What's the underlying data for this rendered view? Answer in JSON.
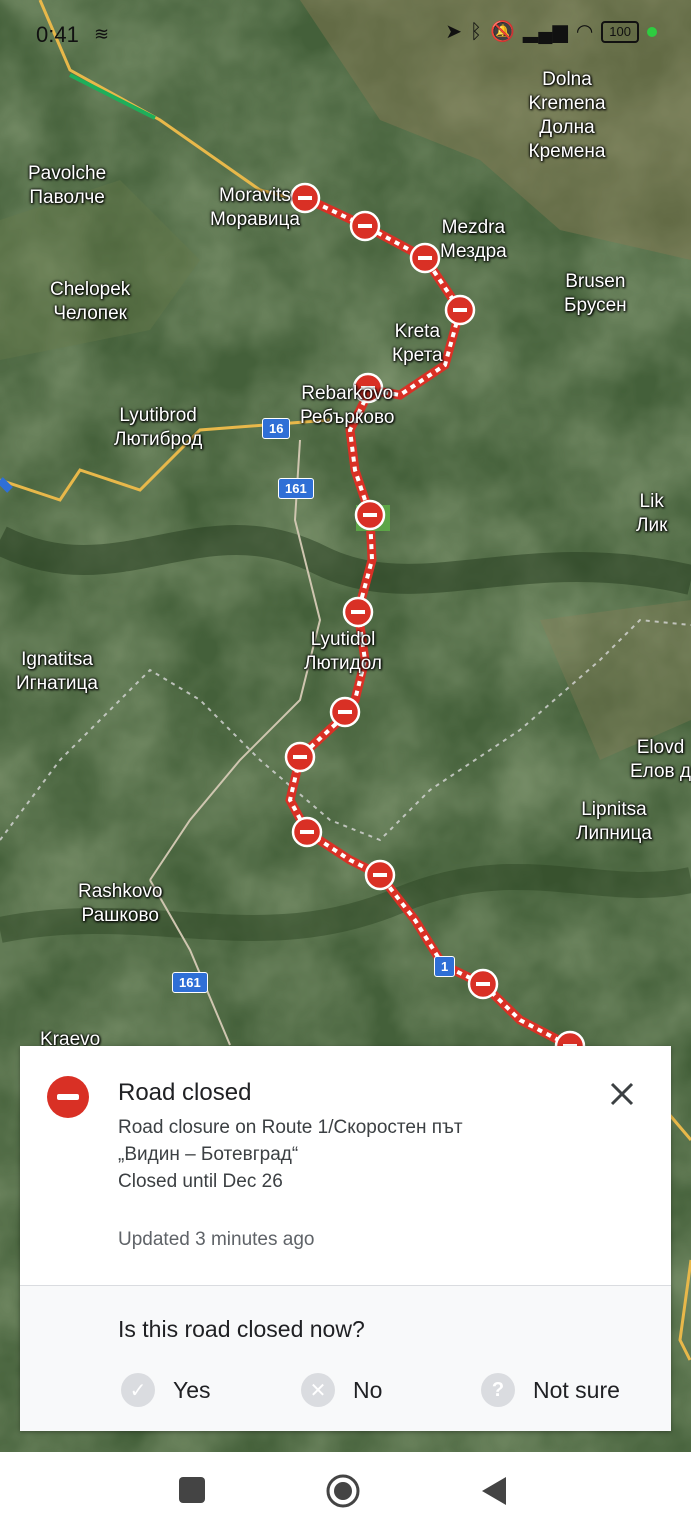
{
  "status_bar": {
    "time": "0:41",
    "battery": "100",
    "icons": [
      "layers-icon",
      "location-arrow-icon",
      "bluetooth-icon",
      "mute-icon",
      "signal-icon",
      "wifi-icon",
      "battery-icon"
    ]
  },
  "map": {
    "places": [
      {
        "lat": "Pavolche",
        "cyr": "Паволче"
      },
      {
        "lat": "Moravits",
        "cyr": "Моравица"
      },
      {
        "lat": "Dolna Kremena",
        "cyr": "Долна Кремена"
      },
      {
        "lat": "Mezdra",
        "cyr": "Мездра"
      },
      {
        "lat": "Chelopek",
        "cyr": "Челопек"
      },
      {
        "lat": "Brusen",
        "cyr": "Брусен"
      },
      {
        "lat": "Kreta",
        "cyr": "Крета"
      },
      {
        "lat": "Rebarkovo",
        "cyr": "Ребърково"
      },
      {
        "lat": "Lyutibrod",
        "cyr": "Лютиброд"
      },
      {
        "lat": "Lik",
        "cyr": "Лик"
      },
      {
        "lat": "Lyutidol",
        "cyr": "Лютидол"
      },
      {
        "lat": "Ignatitsa",
        "cyr": "Игнатица"
      },
      {
        "lat": "Elovd",
        "cyr": "Елов д"
      },
      {
        "lat": "Lipnitsa",
        "cyr": "Липница"
      },
      {
        "lat": "Rashkovo",
        "cyr": "Рашково"
      },
      {
        "lat": "Kraevo",
        "cyr": ""
      }
    ],
    "road_shields": [
      "16",
      "161",
      "161",
      "1"
    ],
    "colors": {
      "closure": "#d93025",
      "road": "#e8b84a",
      "route_shield": "#2f6fd6"
    }
  },
  "card": {
    "title": "Road closed",
    "description_line1": "Road closure on Route 1/Скоростен път",
    "description_line2": "„Видин – Ботевград“",
    "closed_until": "Closed until Dec 26",
    "updated": "Updated 3 minutes ago",
    "question": "Is this road closed now?",
    "options": [
      {
        "label": "Yes",
        "icon": "check-icon"
      },
      {
        "label": "No",
        "icon": "x-circle-icon"
      },
      {
        "label": "Not sure",
        "icon": "question-icon"
      }
    ]
  },
  "nav": {
    "buttons": [
      "recents-button",
      "home-button",
      "back-button"
    ]
  }
}
